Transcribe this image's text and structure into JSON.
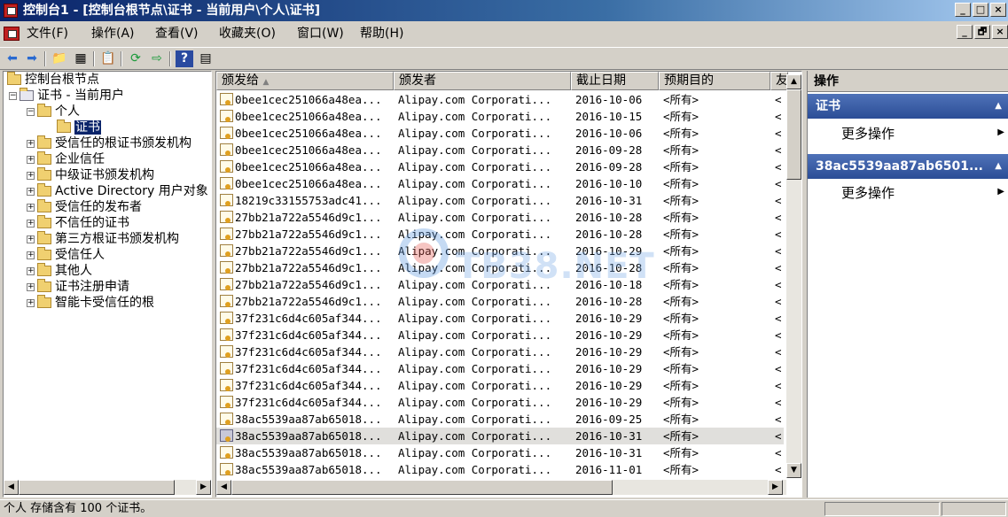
{
  "window": {
    "title": "控制台1 - [控制台根节点\\证书 - 当前用户\\个人\\证书]",
    "buttons": [
      "_",
      "□",
      "×"
    ]
  },
  "menu": {
    "items": [
      "文件(F)",
      "操作(A)",
      "查看(V)",
      "收藏夹(O)",
      "窗口(W)",
      "帮助(H)"
    ],
    "mdi_buttons": [
      "_",
      "🗗",
      "×"
    ]
  },
  "toolbar": {
    "icons": [
      "back-icon",
      "forward-icon",
      "up-folder-icon",
      "show-tree-icon",
      "export-list-icon",
      "refresh-icon",
      "export-icon",
      "help-icon",
      "action-pane-icon"
    ]
  },
  "tree": {
    "root": "控制台根节点",
    "store": "证书 - 当前用户",
    "personal": "个人",
    "selected": "证书",
    "folders": [
      "受信任的根证书颁发机构",
      "企业信任",
      "中级证书颁发机构",
      "Active Directory 用户对象",
      "受信任的发布者",
      "不信任的证书",
      "第三方根证书颁发机构",
      "受信任人",
      "其他人",
      "证书注册申请",
      "智能卡受信任的根"
    ]
  },
  "list": {
    "columns": [
      "颁发给",
      "颁发者",
      "截止日期",
      "预期目的",
      "友"
    ],
    "sort_indicator": "▲",
    "rows": [
      {
        "issued_to": "0bee1cec251066a48ea...",
        "issuer": "Alipay.com Corporati...",
        "expires": "2016-10-06",
        "purpose": "<所有>",
        "friendly": "<"
      },
      {
        "issued_to": "0bee1cec251066a48ea...",
        "issuer": "Alipay.com Corporati...",
        "expires": "2016-10-15",
        "purpose": "<所有>",
        "friendly": "<"
      },
      {
        "issued_to": "0bee1cec251066a48ea...",
        "issuer": "Alipay.com Corporati...",
        "expires": "2016-10-06",
        "purpose": "<所有>",
        "friendly": "<"
      },
      {
        "issued_to": "0bee1cec251066a48ea...",
        "issuer": "Alipay.com Corporati...",
        "expires": "2016-09-28",
        "purpose": "<所有>",
        "friendly": "<"
      },
      {
        "issued_to": "0bee1cec251066a48ea...",
        "issuer": "Alipay.com Corporati...",
        "expires": "2016-09-28",
        "purpose": "<所有>",
        "friendly": "<"
      },
      {
        "issued_to": "0bee1cec251066a48ea...",
        "issuer": "Alipay.com Corporati...",
        "expires": "2016-10-10",
        "purpose": "<所有>",
        "friendly": "<"
      },
      {
        "issued_to": "18219c33155753adc41...",
        "issuer": "Alipay.com Corporati...",
        "expires": "2016-10-31",
        "purpose": "<所有>",
        "friendly": "<"
      },
      {
        "issued_to": "27bb21a722a5546d9c1...",
        "issuer": "Alipay.com Corporati...",
        "expires": "2016-10-28",
        "purpose": "<所有>",
        "friendly": "<"
      },
      {
        "issued_to": "27bb21a722a5546d9c1...",
        "issuer": "Alipay.com Corporati...",
        "expires": "2016-10-28",
        "purpose": "<所有>",
        "friendly": "<"
      },
      {
        "issued_to": "27bb21a722a5546d9c1...",
        "issuer": "Alipay.com Corporati...",
        "expires": "2016-10-29",
        "purpose": "<所有>",
        "friendly": "<"
      },
      {
        "issued_to": "27bb21a722a5546d9c1...",
        "issuer": "Alipay.com Corporati...",
        "expires": "2016-10-28",
        "purpose": "<所有>",
        "friendly": "<"
      },
      {
        "issued_to": "27bb21a722a5546d9c1...",
        "issuer": "Alipay.com Corporati...",
        "expires": "2016-10-18",
        "purpose": "<所有>",
        "friendly": "<"
      },
      {
        "issued_to": "27bb21a722a5546d9c1...",
        "issuer": "Alipay.com Corporati...",
        "expires": "2016-10-28",
        "purpose": "<所有>",
        "friendly": "<"
      },
      {
        "issued_to": "37f231c6d4c605af344...",
        "issuer": "Alipay.com Corporati...",
        "expires": "2016-10-29",
        "purpose": "<所有>",
        "friendly": "<"
      },
      {
        "issued_to": "37f231c6d4c605af344...",
        "issuer": "Alipay.com Corporati...",
        "expires": "2016-10-29",
        "purpose": "<所有>",
        "friendly": "<"
      },
      {
        "issued_to": "37f231c6d4c605af344...",
        "issuer": "Alipay.com Corporati...",
        "expires": "2016-10-29",
        "purpose": "<所有>",
        "friendly": "<"
      },
      {
        "issued_to": "37f231c6d4c605af344...",
        "issuer": "Alipay.com Corporati...",
        "expires": "2016-10-29",
        "purpose": "<所有>",
        "friendly": "<"
      },
      {
        "issued_to": "37f231c6d4c605af344...",
        "issuer": "Alipay.com Corporati...",
        "expires": "2016-10-29",
        "purpose": "<所有>",
        "friendly": "<"
      },
      {
        "issued_to": "37f231c6d4c605af344...",
        "issuer": "Alipay.com Corporati...",
        "expires": "2016-10-29",
        "purpose": "<所有>",
        "friendly": "<"
      },
      {
        "issued_to": "38ac5539aa87ab65018...",
        "issuer": "Alipay.com Corporati...",
        "expires": "2016-09-25",
        "purpose": "<所有>",
        "friendly": "<"
      },
      {
        "issued_to": "38ac5539aa87ab65018...",
        "issuer": "Alipay.com Corporati...",
        "expires": "2016-10-31",
        "purpose": "<所有>",
        "friendly": "<",
        "selected": true
      },
      {
        "issued_to": "38ac5539aa87ab65018...",
        "issuer": "Alipay.com Corporati...",
        "expires": "2016-10-31",
        "purpose": "<所有>",
        "friendly": "<"
      },
      {
        "issued_to": "38ac5539aa87ab65018...",
        "issuer": "Alipay.com Corporati...",
        "expires": "2016-11-01",
        "purpose": "<所有>",
        "friendly": "<"
      }
    ]
  },
  "actions": {
    "header": "操作",
    "sections": [
      {
        "title": "证书",
        "item": "更多操作"
      },
      {
        "title": "38ac5539aa87ab6501...",
        "item": "更多操作"
      }
    ]
  },
  "watermark": "TB38.NET",
  "status": {
    "text": "个人 存储含有 100 个证书。"
  }
}
